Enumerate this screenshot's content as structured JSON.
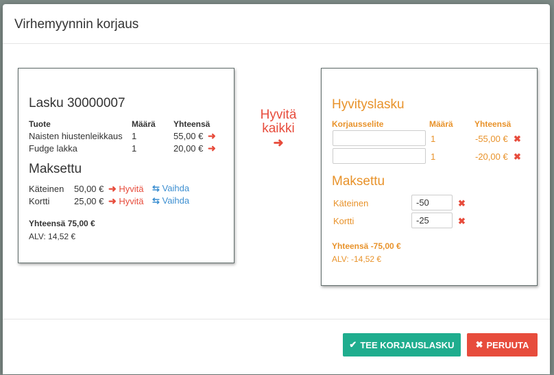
{
  "modal": {
    "title": "Virhemyynnin korjaus"
  },
  "invoice": {
    "title": "Lasku 30000007",
    "headers": {
      "product": "Tuote",
      "qty": "Määrä",
      "total": "Yhteensä"
    },
    "rows": [
      {
        "product": "Naisten hiustenleikkaus",
        "qty": "1",
        "total": "55,00 €"
      },
      {
        "product": "Fudge lakka",
        "qty": "1",
        "total": "20,00 €"
      }
    ],
    "paid_title": "Maksettu",
    "payments": [
      {
        "method": "Käteinen",
        "amount": "50,00 €",
        "refund": "Hyvitä",
        "swap": "Vaihda"
      },
      {
        "method": "Kortti",
        "amount": "25,00 €",
        "refund": "Hyvitä",
        "swap": "Vaihda"
      }
    ],
    "sum": "Yhteensä 75,00 €",
    "vat": "ALV: 14,52 €"
  },
  "refund_all": {
    "line1": "Hyvitä",
    "line2": "kaikki"
  },
  "credit": {
    "title": "Hyvityslasku",
    "headers": {
      "reason": "Korjausselite",
      "qty": "Määrä",
      "total": "Yhteensä"
    },
    "rows": [
      {
        "reason": "",
        "qty": "1",
        "total": "-55,00 €"
      },
      {
        "reason": "",
        "qty": "1",
        "total": "-20,00 €"
      }
    ],
    "paid_title": "Maksettu",
    "payments": [
      {
        "method": "Käteinen",
        "value": "-50"
      },
      {
        "method": "Kortti",
        "value": "-25"
      }
    ],
    "sum": "Yhteensä -75,00 €",
    "vat": "ALV: -14,52 €"
  },
  "footer": {
    "submit": "TEE KORJAUSLASKU",
    "cancel": "PERUUTA"
  },
  "colors": {
    "accent": "#e8922a",
    "danger": "#e74c3c",
    "success": "#1fad8e",
    "link": "#3d8fd1"
  }
}
